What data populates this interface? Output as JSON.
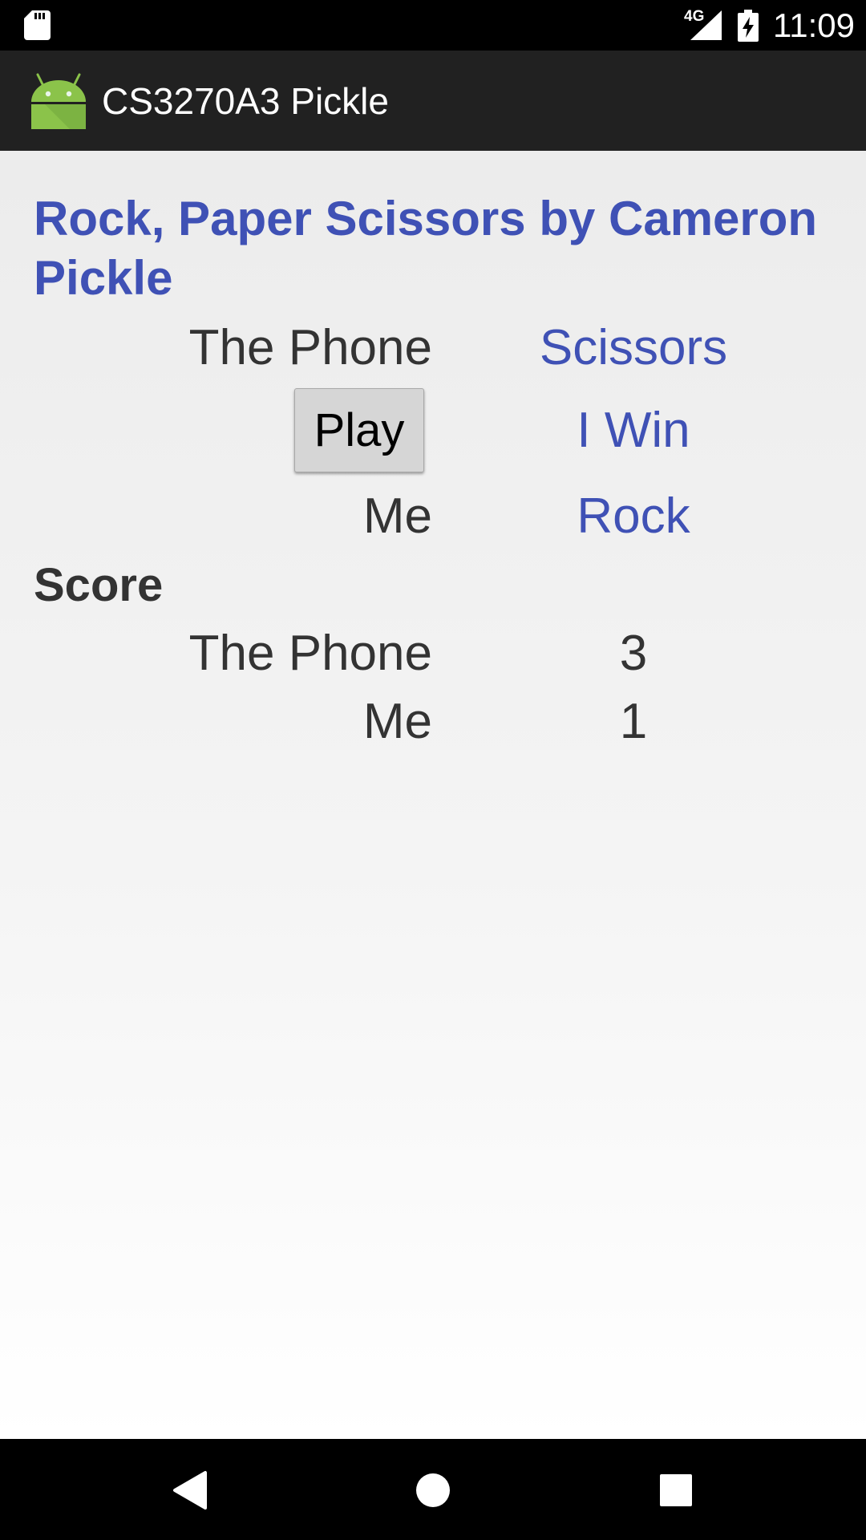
{
  "status_bar": {
    "network": "4G",
    "time": "11:09",
    "icons": [
      "sd-card-icon",
      "signal-icon",
      "battery-charging-icon"
    ]
  },
  "action_bar": {
    "title": "CS3270A3 Pickle",
    "icon": "android-icon"
  },
  "game": {
    "heading": "Rock, Paper Scissors by Cameron Pickle",
    "phone_label": "The Phone",
    "phone_choice": "Scissors",
    "play_button": "Play",
    "result": "I Win",
    "me_label": "Me",
    "me_choice": "Rock"
  },
  "score": {
    "heading": "Score",
    "phone_label": "The Phone",
    "phone_score": "3",
    "me_label": "Me",
    "me_score": "1"
  },
  "nav_bar": {
    "buttons": [
      "back-icon",
      "home-icon",
      "recents-icon"
    ]
  },
  "colors": {
    "accent": "#3f51b5",
    "action_bar": "#212121",
    "text_dark": "#333333",
    "android_green": "#8bc34a"
  }
}
